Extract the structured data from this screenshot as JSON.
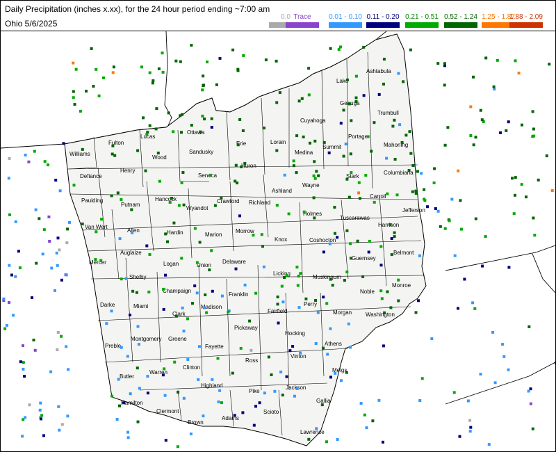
{
  "title": "Daily Precipitation (inches  x.xx),  for the 24 hour period ending ~7:00 am",
  "subtitle": "Ohio 5/6/2025",
  "legend": [
    {
      "label": "0.0",
      "color": "#aaaaaa",
      "text_color": "#aaaaaa"
    },
    {
      "label": "Trace",
      "color": "#8844cc",
      "text_color": "#8844cc"
    },
    {
      "label": "0.01 - 0.10",
      "color": "#3399ff",
      "text_color": "#3399ff"
    },
    {
      "label": "0.11 - 0.20",
      "color": "#000080",
      "text_color": "#000080"
    },
    {
      "label": "0.21 - 0.51",
      "color": "#00aa00",
      "text_color": "#008800"
    },
    {
      "label": "0.52 - 1.24",
      "color": "#006600",
      "text_color": "#006600"
    },
    {
      "label": "1.25 - 1.87",
      "color": "#ff7700",
      "text_color": "#ff7700"
    },
    {
      "label": "1.88 - 2.09",
      "color": "#cc3300",
      "text_color": "#cc3300"
    }
  ],
  "counties": [
    "Williams",
    "Fulton",
    "Lucas",
    "Ottawa",
    "Sandusky",
    "Wood",
    "Erie",
    "Lorain",
    "Cuyahoga",
    "Lake",
    "Ashtabula",
    "Geauga",
    "Trumbull",
    "Portage",
    "Summit",
    "Medina",
    "Huron",
    "Seneca",
    "Henry",
    "Defiance",
    "Paulding",
    "Putnam",
    "Hancock",
    "Wyandot",
    "Crawford",
    "Richland",
    "Ashland",
    "Wayne",
    "Stark",
    "Mahoning",
    "Columbiana",
    "Carroll",
    "Jefferson",
    "Harrison",
    "Tuscarawas",
    "Holmes",
    "Coshocton",
    "Knox",
    "Morrow",
    "Marion",
    "Hardin",
    "Allen",
    "Van Wert",
    "Mercer",
    "Auglaize",
    "Shelby",
    "Logan",
    "Union",
    "Delaware",
    "Licking",
    "Muskingum",
    "Guernsey",
    "Belmont",
    "Monroe",
    "Noble",
    "Washington",
    "Morgan",
    "Perry",
    "Fairfield",
    "Franklin",
    "Madison",
    "Clark",
    "Champaign",
    "Miami",
    "Darke",
    "Preble",
    "Montgomery",
    "Greene",
    "Fayette",
    "Pickaway",
    "Hocking",
    "Athens",
    "Vinton",
    "Meigs",
    "Ross",
    "Highland",
    "Clinton",
    "Warren",
    "Butler",
    "Hamilton",
    "Clermont",
    "Brown",
    "Adams",
    "Pike",
    "Scioto",
    "Jackson",
    "Gallia",
    "Lawrence"
  ]
}
